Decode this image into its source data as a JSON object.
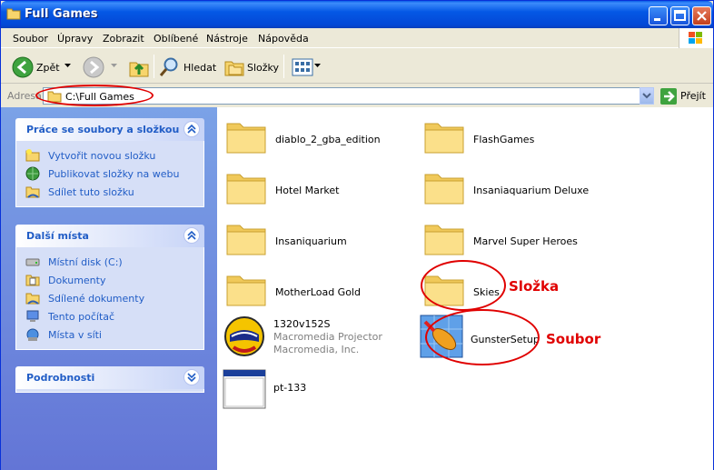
{
  "window": {
    "title": "Full Games"
  },
  "menu": [
    "Soubor",
    "Úpravy",
    "Zobrazit",
    "Oblíbené",
    "Nástroje",
    "Nápověda"
  ],
  "toolbar": {
    "back": "Zpět",
    "search": "Hledat",
    "folders": "Složky"
  },
  "address": {
    "label": "Adresa",
    "value": "C:\\Full Games",
    "go": "Přejít"
  },
  "tasks": {
    "title": "Práce se soubory a složkou",
    "items": [
      "Vytvořit novou složku",
      "Publikovat složky na webu",
      "Sdílet tuto složku"
    ]
  },
  "places": {
    "title": "Další místa",
    "items": [
      "Místní disk (C:)",
      "Dokumenty",
      "Sdílené dokumenty",
      "Tento počítač",
      "Místa v síti"
    ]
  },
  "details": {
    "title": "Podrobnosti"
  },
  "files": [
    {
      "name": "diablo_2_gba_edition"
    },
    {
      "name": "FlashGames"
    },
    {
      "name": "Hotel Market"
    },
    {
      "name": "Insaniaquarium Deluxe"
    },
    {
      "name": "Insaniquarium"
    },
    {
      "name": "Marvel Super Heroes"
    },
    {
      "name": "MotherLoad Gold"
    },
    {
      "name": "Skies"
    },
    {
      "name": "1320v152S",
      "sub1": "Macromedia Projector",
      "sub2": "Macromedia, Inc."
    },
    {
      "name": "GunsterSetup"
    },
    {
      "name": "pt-133"
    }
  ],
  "annotations": {
    "folder": "Složka",
    "file": "Soubor"
  },
  "colors": {
    "annotation": "#e00000",
    "title_bar": "#0458e5",
    "task_link": "#215dc6"
  }
}
